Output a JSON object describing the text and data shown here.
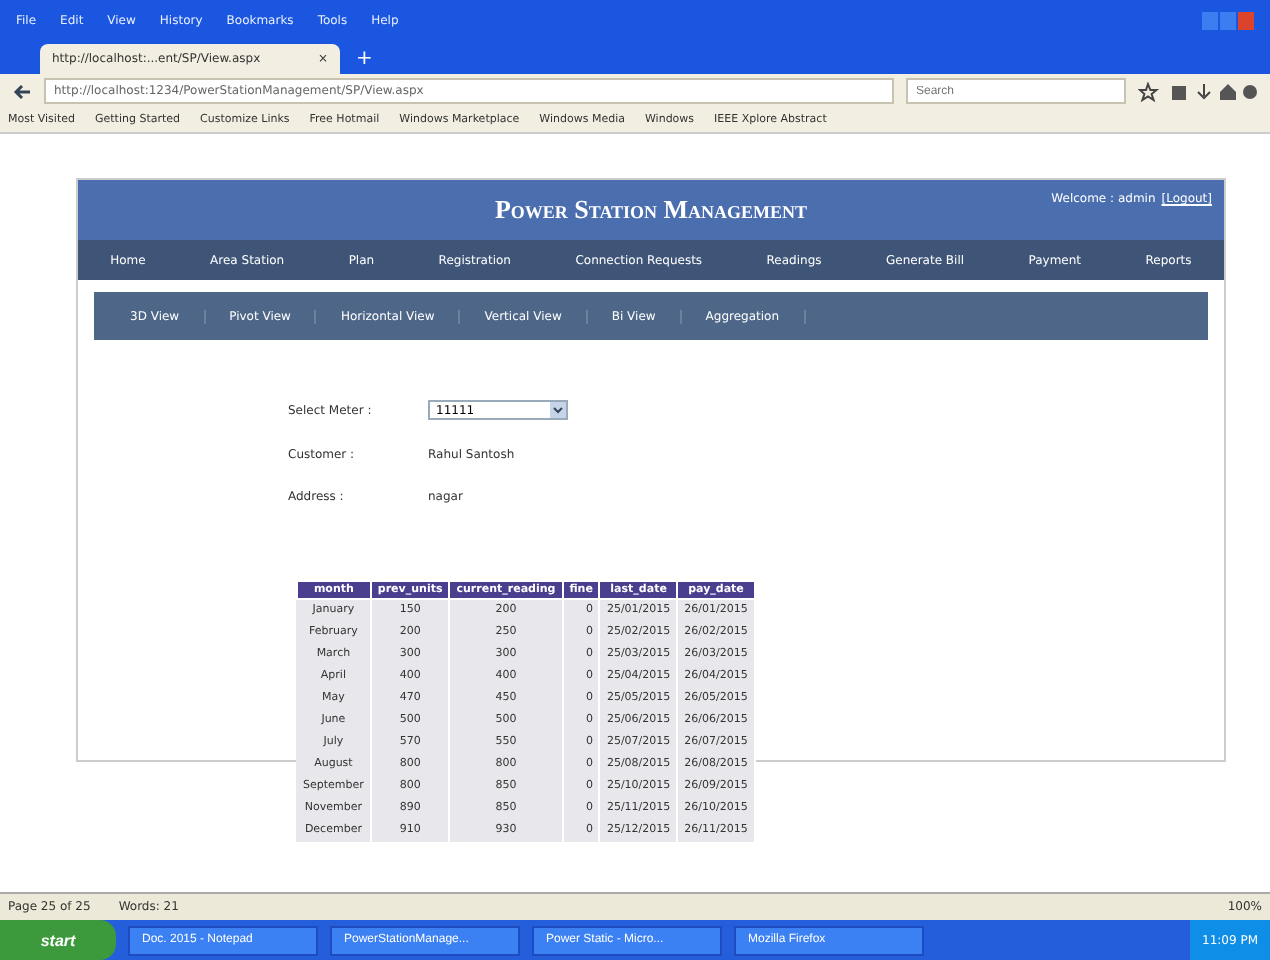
{
  "browser": {
    "menu": [
      "File",
      "Edit",
      "View",
      "History",
      "Bookmarks",
      "Tools",
      "Help"
    ],
    "tab": {
      "title": "http://localhost:...ent/SP/View.aspx",
      "close": "×",
      "new": "+"
    },
    "url": "http://localhost:1234/PowerStationManagement/SP/View.aspx",
    "search": {
      "placeholder": "Search"
    },
    "bookmarks": [
      "Most Visited",
      "Getting Started",
      "Customize Links",
      "Free Hotmail",
      "Windows Marketplace",
      "Windows Media",
      "Windows",
      "IEEE Xplore Abstract"
    ]
  },
  "site": {
    "title": "Power Station Management",
    "welcome": "Welcome : admin",
    "logout": "[Logout]",
    "nav": [
      {
        "label": "Home",
        "selected": false
      },
      {
        "label": "Area Station",
        "selected": false
      },
      {
        "label": "Plan",
        "selected": false
      },
      {
        "label": "Registration",
        "selected": false
      },
      {
        "label": "Connection Requests",
        "selected": false
      },
      {
        "label": "Readings",
        "selected": false
      },
      {
        "label": "Generate Bill",
        "selected": false
      },
      {
        "label": "Payment",
        "selected": false
      },
      {
        "label": "Reports",
        "selected": false
      }
    ],
    "subnav": [
      {
        "label": "3D View",
        "selected": false
      },
      {
        "label": "Pivot View",
        "selected": false
      },
      {
        "label": "Horizontal View",
        "selected": false
      },
      {
        "label": "Vertical View",
        "selected": false
      },
      {
        "label": "Bi View",
        "selected": false
      },
      {
        "label": "Aggregation",
        "selected": false
      }
    ]
  },
  "form": {
    "meter_label": "Select Meter :",
    "meter_value": "11111",
    "customer_label": "Customer :",
    "customer_value": "Rahul Santosh",
    "address_label": "Address :",
    "address_value": "nagar"
  },
  "table": {
    "columns": [
      "month",
      "prev_units",
      "current_reading",
      "fine",
      "last_date",
      "pay_date"
    ],
    "rows": [
      [
        "January",
        "150",
        "200",
        "0",
        "25/01/2015",
        "26/01/2015"
      ],
      [
        "February",
        "200",
        "250",
        "0",
        "25/02/2015",
        "26/02/2015"
      ],
      [
        "March",
        "300",
        "300",
        "0",
        "25/03/2015",
        "26/03/2015"
      ],
      [
        "April",
        "400",
        "400",
        "0",
        "25/04/2015",
        "26/04/2015"
      ],
      [
        "May",
        "470",
        "450",
        "0",
        "25/05/2015",
        "26/05/2015"
      ],
      [
        "June",
        "500",
        "500",
        "0",
        "25/06/2015",
        "26/06/2015"
      ],
      [
        "July",
        "570",
        "550",
        "0",
        "25/07/2015",
        "26/07/2015"
      ],
      [
        "August",
        "800",
        "800",
        "0",
        "25/08/2015",
        "26/08/2015"
      ],
      [
        "September",
        "800",
        "850",
        "0",
        "25/10/2015",
        "26/09/2015"
      ],
      [
        "November",
        "890",
        "850",
        "0",
        "25/11/2015",
        "26/10/2015"
      ],
      [
        "December",
        "910",
        "930",
        "0",
        "25/12/2015",
        "26/11/2015"
      ]
    ]
  },
  "status_bar": [
    "Page 25 of 25",
    "Words: 21",
    "100%"
  ],
  "taskbar": {
    "start": "start",
    "items": [
      "Doc. 2015 - Notepad",
      "PowerStationManage...",
      "Power Static - Micro...",
      "Mozilla Firefox"
    ],
    "time": "11:09 PM"
  }
}
